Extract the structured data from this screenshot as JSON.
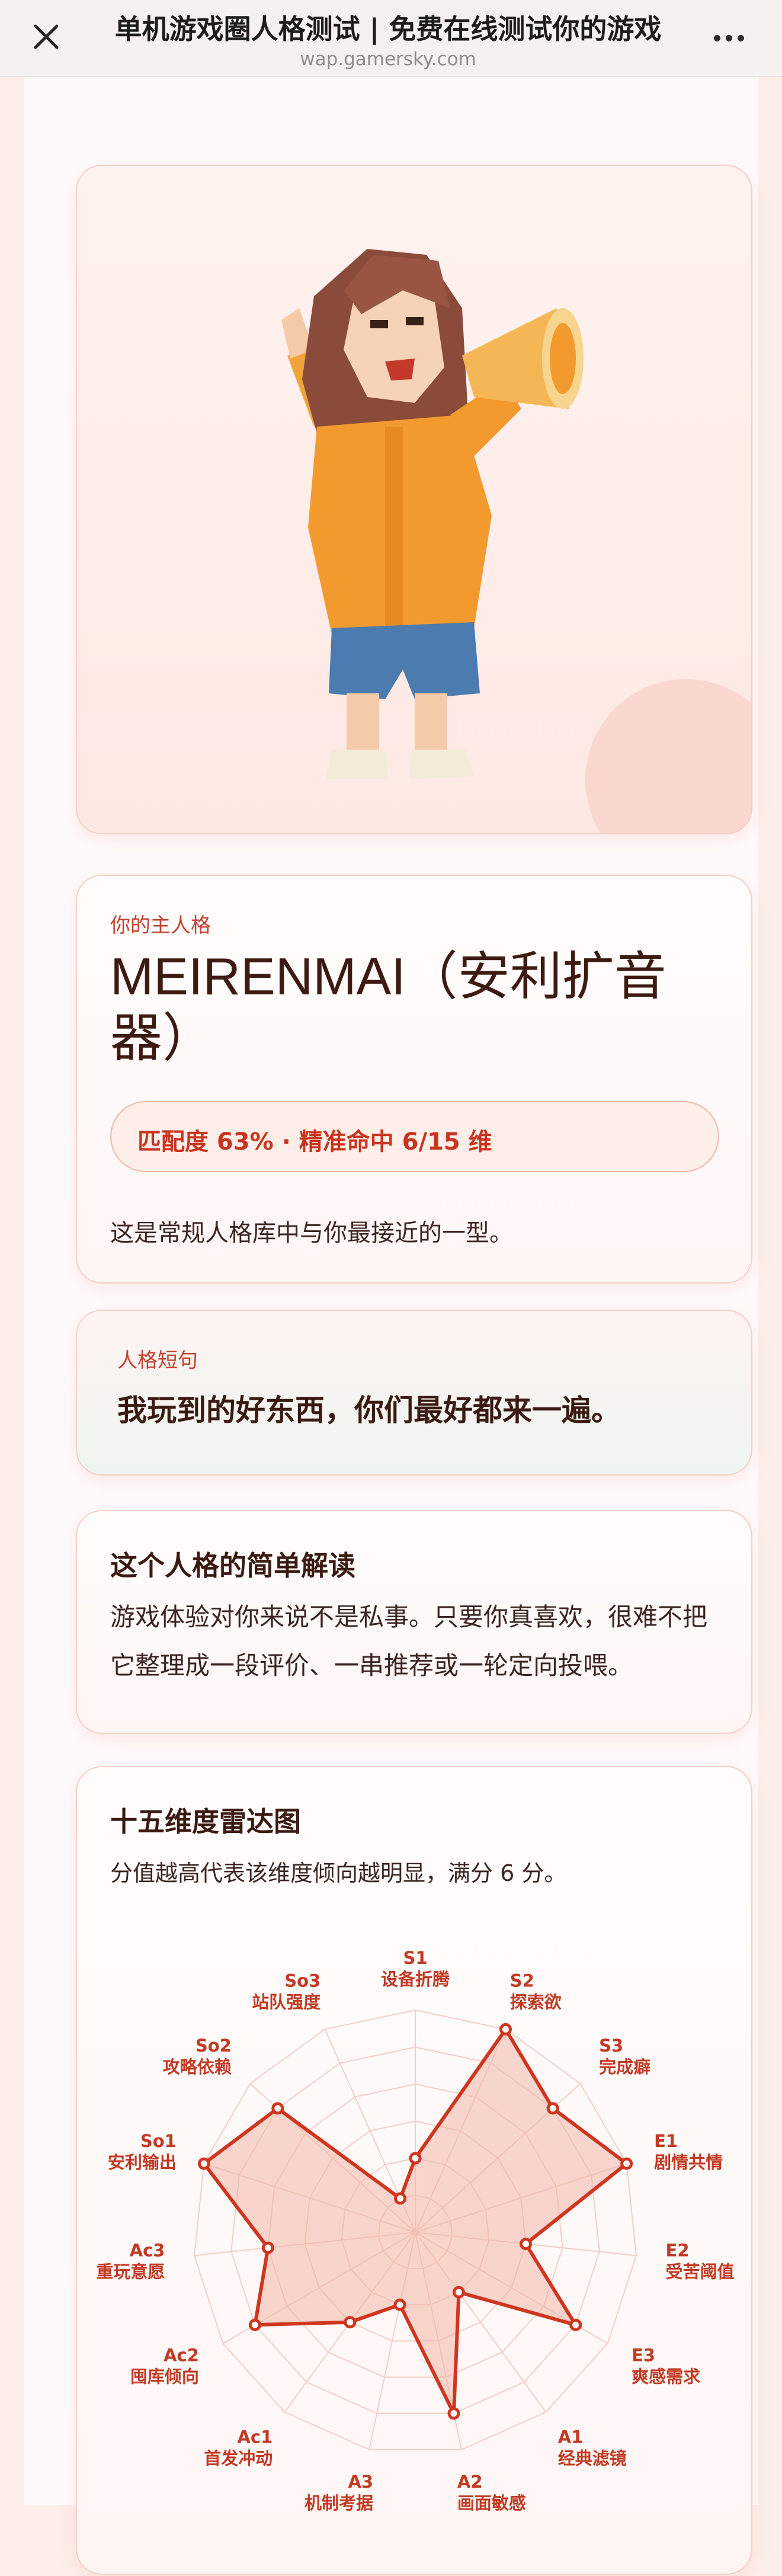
{
  "browser": {
    "title": "单机游戏圈人格测试 | 免费在线测试你的游戏",
    "url": "wap.gamersky.com",
    "close_icon": "close-icon",
    "more_icon": "more-icon"
  },
  "hero": {
    "illustration": "megaphone-girl-illustration"
  },
  "persona": {
    "eyebrow": "你的主人格",
    "name": "MEIRENMAI（安利扩音器）",
    "match": "匹配度 63% · 精准命中 6/15 维",
    "description": "这是常规人格库中与你最接近的一型。"
  },
  "quote": {
    "eyebrow": "人格短句",
    "text": "我玩到的好东西，你们最好都来一遍。"
  },
  "brief": {
    "title": "这个人格的简单解读",
    "body": "游戏体验对你来说不是私事。只要你真喜欢，很难不把它整理成一段评价、一串推荐或一轮定向投喂。"
  },
  "radar": {
    "title": "十五维度雷达图",
    "note": "分值越高代表该维度倾向越明显，满分 6 分。"
  },
  "chart_data": {
    "type": "radar",
    "max": 6,
    "rings": 6,
    "colors": {
      "line": "#d0361f",
      "fill": "#f3b7a8",
      "grid": "#f2cfc8",
      "label": "#c23a24"
    },
    "axes": [
      {
        "code": "S1",
        "name": "设备折腾"
      },
      {
        "code": "S2",
        "name": "探索欲"
      },
      {
        "code": "S3",
        "name": "完成癖"
      },
      {
        "code": "E1",
        "name": "剧情共情"
      },
      {
        "code": "E2",
        "name": "受苦阈值"
      },
      {
        "code": "E3",
        "name": "爽感需求"
      },
      {
        "code": "A1",
        "name": "经典滤镜"
      },
      {
        "code": "A2",
        "name": "画面敏感"
      },
      {
        "code": "A3",
        "name": "机制考据"
      },
      {
        "code": "Ac1",
        "name": "首发冲动"
      },
      {
        "code": "Ac2",
        "name": "囤库倾向"
      },
      {
        "code": "Ac3",
        "name": "重玩意愿"
      },
      {
        "code": "So1",
        "name": "安利输出"
      },
      {
        "code": "So2",
        "name": "攻略依赖"
      },
      {
        "code": "So3",
        "name": "站队强度"
      }
    ],
    "values": [
      2,
      6,
      5,
      6,
      3,
      5,
      2,
      5,
      2,
      3,
      5,
      4,
      6,
      5,
      1
    ]
  }
}
